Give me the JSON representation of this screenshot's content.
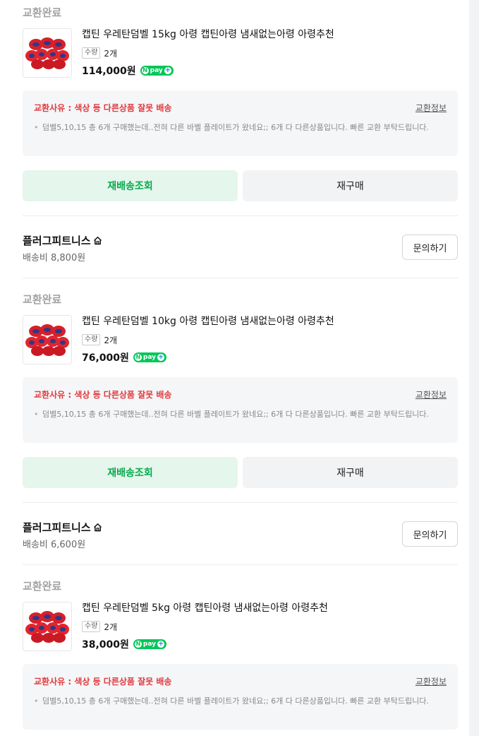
{
  "orders": [
    {
      "status": "교환완료",
      "product_name": "캡틴 우레탄덤벨 15kg 아령 캡틴아령 냄새없는아령 아령추천",
      "qty_label": "수량",
      "qty_value": "2개",
      "price": "114,000원",
      "npay": "pay",
      "reason_title": "교환사유 : 색상 등 다른상품 잘못 배송",
      "reason_link": "교환정보",
      "reason_desc": "덤벨5,10,15 총 6개 구매했는데..전혀 다른 바벨 플레이트가 왔네요;; 6개 다 다른상품입니다. 빠른 교환 부탁드립니다.",
      "btn_track": "재배송조회",
      "btn_rebuy": "재구매",
      "store_name": "플러그피트니스",
      "shipping": "배송비 8,800원",
      "ask_label": "문의하기"
    },
    {
      "status": "교환완료",
      "product_name": "캡틴 우레탄덤벨 10kg 아령 캡틴아령 냄새없는아령 아령추천",
      "qty_label": "수량",
      "qty_value": "2개",
      "price": "76,000원",
      "npay": "pay",
      "reason_title": "교환사유 : 색상 등 다른상품 잘못 배송",
      "reason_link": "교환정보",
      "reason_desc": "덤벨5,10,15 총 6개 구매했는데..전혀 다른 바벨 플레이트가 왔네요;; 6개 다 다른상품입니다. 빠른 교환 부탁드립니다.",
      "btn_track": "재배송조회",
      "btn_rebuy": "재구매",
      "store_name": "플러그피트니스",
      "shipping": "배송비 6,600원",
      "ask_label": "문의하기"
    },
    {
      "status": "교환완료",
      "product_name": "캡틴 우레탄덤벨 5kg 아령 캡틴아령 냄새없는아령 아령추천",
      "qty_label": "수량",
      "qty_value": "2개",
      "price": "38,000원",
      "npay": "pay",
      "reason_title": "교환사유 : 색상 등 다른상품 잘못 배송",
      "reason_link": "교환정보",
      "reason_desc": "덤벨5,10,15 총 6개 구매했는데..전혀 다른 바벨 플레이트가 왔네요;; 6개 다 다른상품입니다. 빠른 교환 부탁드립니다."
    }
  ],
  "colors": {
    "accent_green": "#03c75a",
    "reason_red": "#e03a3e",
    "status_gray": "#a3a3a3"
  }
}
